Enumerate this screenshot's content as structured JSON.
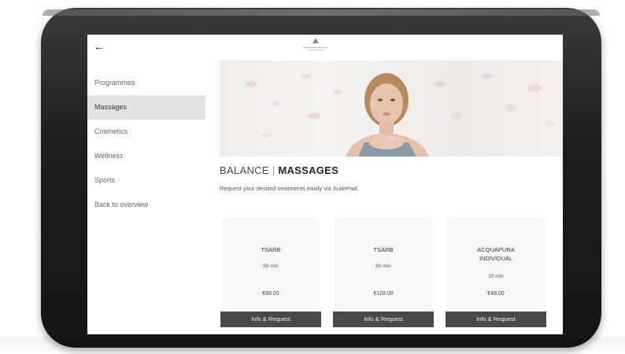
{
  "header": {
    "back_icon": "arrow-left-icon",
    "logo_icon": "hotel-logo-icon"
  },
  "sidebar": {
    "items": [
      {
        "label": "Programmes",
        "active": false
      },
      {
        "label": "Massages",
        "active": true
      },
      {
        "label": "Cosmetics",
        "active": false
      },
      {
        "label": "Wellness",
        "active": false
      },
      {
        "label": "Sports",
        "active": false
      },
      {
        "label": "Back to overview",
        "active": false
      }
    ]
  },
  "main": {
    "title_part1": "BALANCE",
    "title_sep": "|",
    "title_part2": "MASSAGES",
    "subtitle": "Request your desired treatments easily via SuitePad."
  },
  "cards": [
    {
      "name_line1": "TSARB",
      "name_line2": "",
      "duration": "50 min",
      "price": "€86.00",
      "button": "Info & Request"
    },
    {
      "name_line1": "TSARB",
      "name_line2": "",
      "duration": "80 min",
      "price": "€128.00",
      "button": "Info & Request"
    },
    {
      "name_line1": "ACQUAPURA",
      "name_line2": "INDIVIDUAL",
      "duration": "30 min",
      "price": "€48.00",
      "button": "Info & Request"
    }
  ],
  "colors": {
    "button_bg": "#464a4d",
    "active_item_bg": "#e4e4e4",
    "device_frame": "#1e1e1e"
  }
}
